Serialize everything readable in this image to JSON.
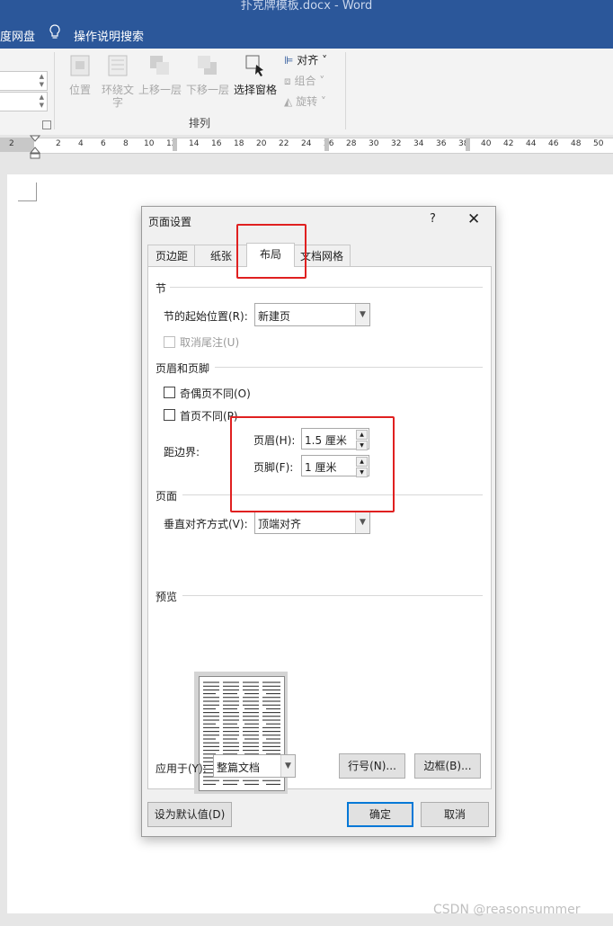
{
  "window": {
    "title": "扑克牌模板.docx  -  Word"
  },
  "menubar": {
    "item_partial": "度网盘",
    "tell_me": "操作说明搜索"
  },
  "ribbon": {
    "buttons": {
      "position": "位置",
      "wrap_text": "环绕文字",
      "bring_forward": "上移一层",
      "send_backward": "下移一层",
      "selection_pane": "选择窗格"
    },
    "small": {
      "align": "对齐",
      "group": "组合",
      "rotate": "旋转"
    },
    "group_label": "排列"
  },
  "ruler": {
    "labels": [
      "2",
      "2",
      "4",
      "6",
      "8",
      "10",
      "12",
      "14",
      "16",
      "18",
      "20",
      "22",
      "24",
      "26",
      "28",
      "30",
      "32",
      "34",
      "36",
      "38",
      "40",
      "42",
      "44",
      "46",
      "48",
      "50"
    ]
  },
  "dialog": {
    "title": "页面设置",
    "help": "?",
    "close": "✕",
    "tabs": [
      "页边距",
      "纸张",
      "布局",
      "文档网格"
    ],
    "active_tab": "布局",
    "section": {
      "heading": "节",
      "start_label": "节的起始位置(R):",
      "start_value": "新建页",
      "suppress_endnotes": "取消尾注(U)"
    },
    "header_footer": {
      "heading": "页眉和页脚",
      "odd_even": "奇偶页不同(O)",
      "first_page": "首页不同(P)",
      "from_edge": "距边界:",
      "header_label": "页眉(H):",
      "header_value": "1.5 厘米",
      "footer_label": "页脚(F):",
      "footer_value": "1 厘米"
    },
    "page": {
      "heading": "页面",
      "valign_label": "垂直对齐方式(V):",
      "valign_value": "顶端对齐"
    },
    "preview": {
      "heading": "预览"
    },
    "apply": {
      "label": "应用于(Y):",
      "value": "整篇文档",
      "line_numbers": "行号(N)...",
      "borders": "边框(B)..."
    },
    "buttons": {
      "set_default": "设为默认值(D)",
      "ok": "确定",
      "cancel": "取消"
    }
  },
  "watermark": "CSDN @reasonsummer",
  "colors": {
    "title_bar": "#2b579a",
    "highlight": "#e02020",
    "primary_button_border": "#0078d7"
  }
}
